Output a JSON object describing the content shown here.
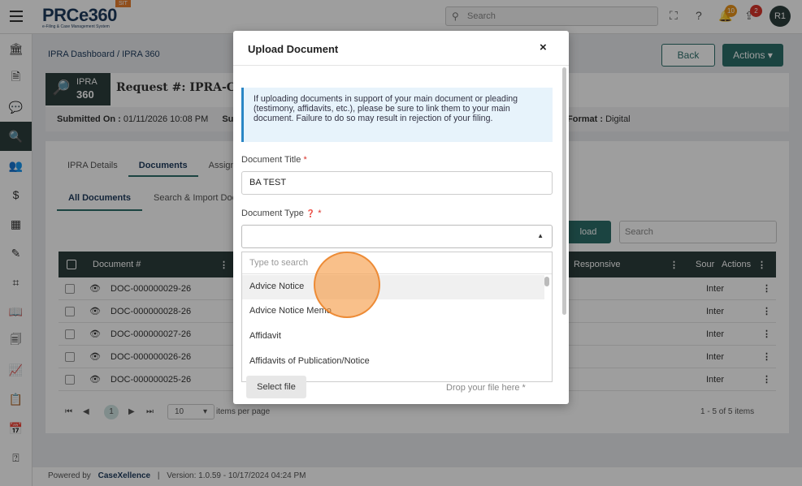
{
  "app": {
    "brand": "PRCe360",
    "brand_tag": "e-Filing & Case Management System",
    "env_badge": "SIT",
    "search_placeholder": "Search",
    "notifications_count": "10",
    "uploads_count": "2",
    "user_initials": "R1"
  },
  "page": {
    "breadcrumb": "IPRA Dashboard / IPRA 360",
    "back_label": "Back",
    "actions_label": "Actions ▾",
    "ipra_logo_top": "IPRA",
    "ipra_logo_bottom": "360",
    "request_title": "Request #: IPRA-CN",
    "submitted_label": "Submitted On :",
    "submitted_value": "01/11/2026 10:08 PM",
    "submitted_trailing": "Su",
    "format_label": "Format :",
    "format_value": "Digital"
  },
  "tabs": [
    "IPRA Details",
    "Documents",
    "Assign"
  ],
  "subtabs": [
    "All Documents",
    "Search & Import Doc"
  ],
  "grid": {
    "upload_label": "load",
    "search_placeholder": "Search",
    "columns": {
      "document": "Document #",
      "responsive": "Responsive",
      "source": "Sour",
      "actions": "Actions"
    },
    "rows": [
      {
        "doc": "DOC-000000029-26",
        "source": "Inter"
      },
      {
        "doc": "DOC-000000028-26",
        "source": "Inter"
      },
      {
        "doc": "DOC-000000027-26",
        "source": "Inter"
      },
      {
        "doc": "DOC-000000026-26",
        "source": "Inter"
      },
      {
        "doc": "DOC-000000025-26",
        "source": "Inter"
      }
    ],
    "pager": {
      "current_page": "1",
      "page_size": "10",
      "items_per_page_label": "items per page",
      "summary": "1 - 5 of 5 items"
    }
  },
  "footer": {
    "powered_by": "Powered by",
    "company": "CaseXellence",
    "version": "Version: 1.0.59 - 10/17/2024 04:24 PM"
  },
  "modal": {
    "title": "Upload Document",
    "close_glyph": "×",
    "info_text": "If uploading documents in support of your main document or pleading (testimony, affidavits, etc.), please be sure to link them to your main document. Failure to do so may result in rejection of your filing.",
    "title_label": "Document Title",
    "title_value": "BA TEST",
    "type_label": "Document Type",
    "required_mark": "*",
    "dropdown": {
      "search_placeholder": "Type to search",
      "options": [
        "Advice Notice",
        "Advice Notice Memo",
        "Affidavit",
        "Affidavits of Publication/Notice"
      ]
    },
    "select_file_label": "Select file",
    "drop_text": "Drop your file here *"
  },
  "colors": {
    "primary": "#2c6e6a",
    "dark_header": "#2c3e3c",
    "info_bg": "#e7f3fb",
    "info_border": "#2a86c5",
    "click_highlight": "#f5963c"
  }
}
